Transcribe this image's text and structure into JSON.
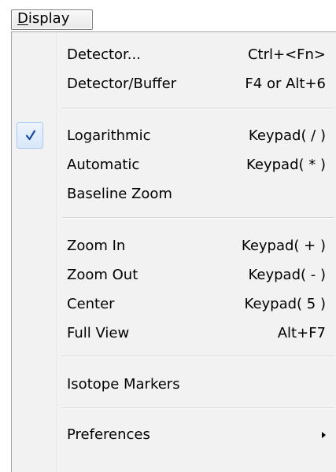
{
  "menubar": {
    "display_menu": {
      "mnemonic": "D",
      "rest": "isplay"
    }
  },
  "menu": {
    "items": [
      {
        "label": "Detector...",
        "shortcut": "Ctrl+<Fn>"
      },
      {
        "label": "Detector/Buffer",
        "shortcut": "F4 or Alt+6"
      },
      {
        "label": "Logarithmic",
        "shortcut": "Keypad( / )",
        "checked": true
      },
      {
        "label": "Automatic",
        "shortcut": "Keypad( * )"
      },
      {
        "label": "Baseline Zoom",
        "shortcut": ""
      },
      {
        "label": "Zoom In",
        "shortcut": "Keypad( + )"
      },
      {
        "label": "Zoom Out",
        "shortcut": "Keypad( - )"
      },
      {
        "label": "Center",
        "shortcut": "Keypad( 5 )"
      },
      {
        "label": "Full View",
        "shortcut": "Alt+F7"
      },
      {
        "label": "Isotope Markers",
        "shortcut": ""
      },
      {
        "label": "Preferences",
        "shortcut": "",
        "submenu": true
      }
    ],
    "check_icon": "checkmark-icon",
    "submenu_icon": "chevron-right-icon"
  },
  "colors": {
    "menu_background": "#f2f2f2",
    "check_highlight": "#d8e7fa",
    "check_border": "#a8c7ec",
    "check_mark": "#1a4a9b"
  }
}
